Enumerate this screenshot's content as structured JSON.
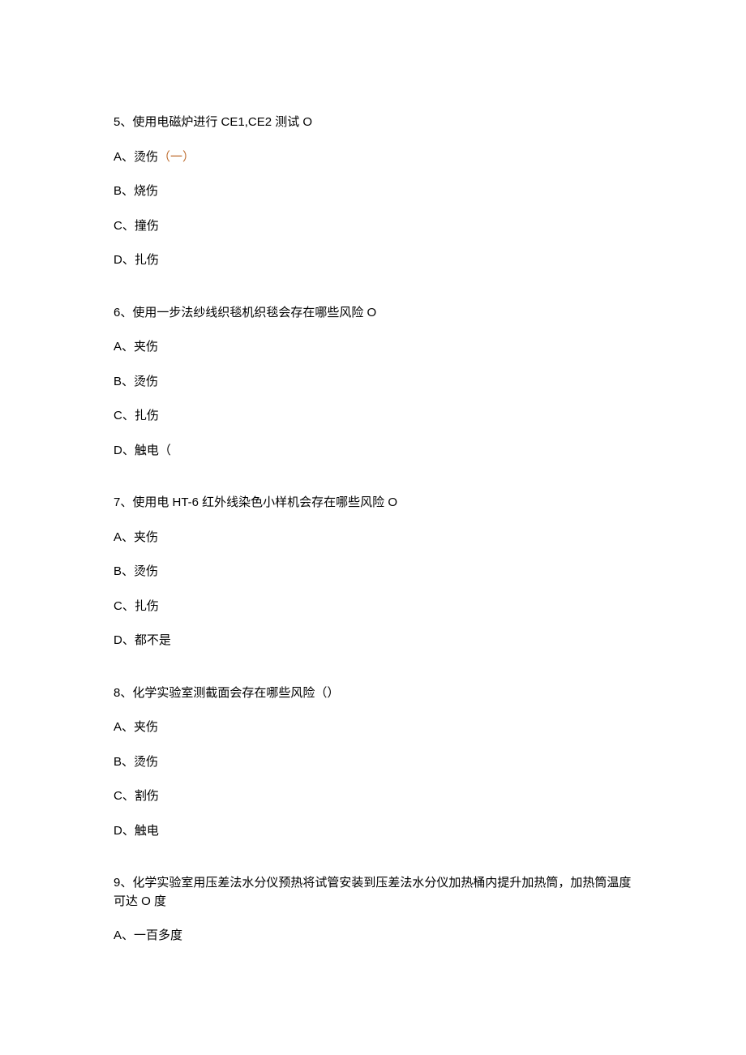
{
  "questions": [
    {
      "stem": "5、使用电磁炉进行 CE1,CE2 测试 O",
      "options": [
        {
          "prefix": "A、烫伤",
          "mark": "（一）"
        },
        {
          "prefix": "B、烧伤",
          "mark": ""
        },
        {
          "prefix": "C、撞伤",
          "mark": ""
        },
        {
          "prefix": "D、扎伤",
          "mark": ""
        }
      ]
    },
    {
      "stem": "6、使用一步法纱线织毯机织毯会存在哪些风险 O",
      "options": [
        {
          "prefix": "A、夹伤",
          "mark": ""
        },
        {
          "prefix": "B、烫伤",
          "mark": ""
        },
        {
          "prefix": "C、扎伤",
          "mark": ""
        },
        {
          "prefix": "D、触电（",
          "mark": ""
        }
      ]
    },
    {
      "stem": "7、使用电 HT-6 红外线染色小样机会存在哪些风险 O",
      "options": [
        {
          "prefix": "A、夹伤",
          "mark": ""
        },
        {
          "prefix": "B、烫伤",
          "mark": ""
        },
        {
          "prefix": "C、扎伤",
          "mark": ""
        },
        {
          "prefix": "D、都不是",
          "mark": ""
        }
      ]
    },
    {
      "stem": "8、化学实验室测截面会存在哪些风险（）",
      "options": [
        {
          "prefix": "A、夹伤",
          "mark": ""
        },
        {
          "prefix": "B、烫伤",
          "mark": ""
        },
        {
          "prefix": "C、割伤",
          "mark": ""
        },
        {
          "prefix": "D、触电",
          "mark": ""
        }
      ]
    },
    {
      "stem": "9、化学实验室用压差法水分仪预热将试管安装到压差法水分仪加热桶内提升加热筒，加热筒温度可达 O 度",
      "options": [
        {
          "prefix": "A、一百多度",
          "mark": ""
        }
      ]
    }
  ]
}
